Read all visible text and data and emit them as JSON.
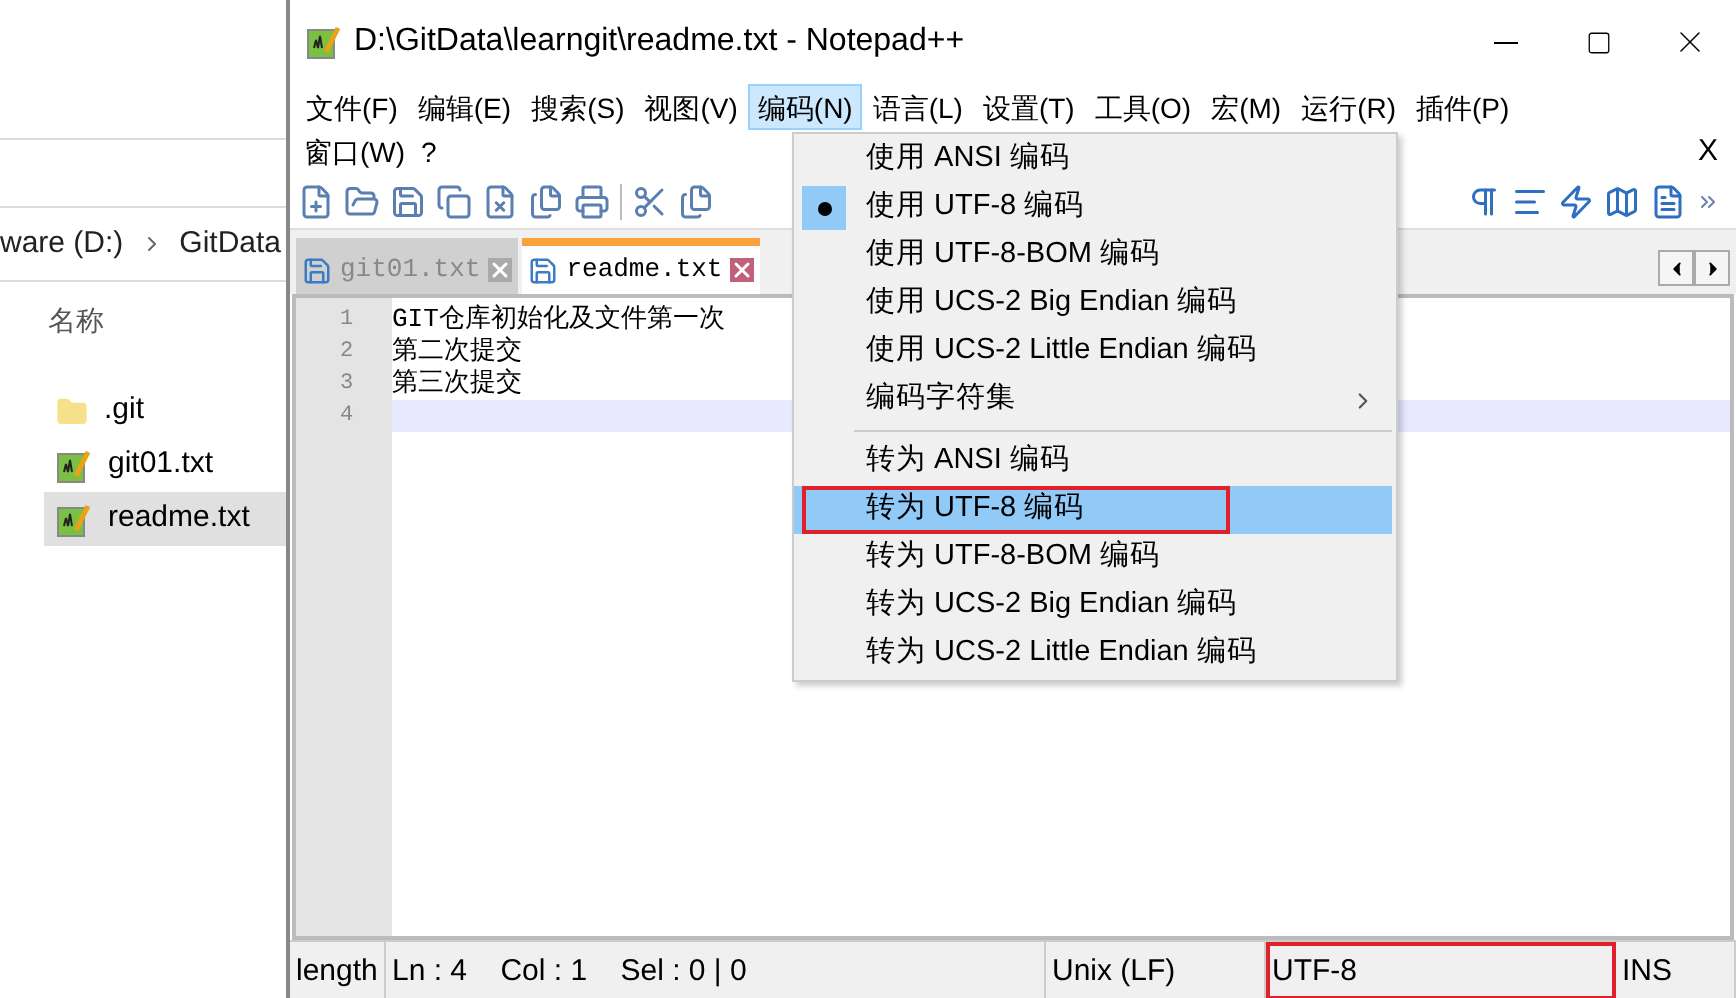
{
  "explorer": {
    "breadcrumb": [
      "ware (D:)",
      "GitData"
    ],
    "column_header": "名称",
    "files": [
      {
        "name": ".git",
        "kind": "folder",
        "selected": false
      },
      {
        "name": "git01.txt",
        "kind": "text",
        "selected": false
      },
      {
        "name": "readme.txt",
        "kind": "text",
        "selected": true
      }
    ]
  },
  "window": {
    "title": "D:\\GitData\\learngit\\readme.txt - Notepad++"
  },
  "menu_bar": [
    {
      "label": "文件(F)",
      "selected": false
    },
    {
      "label": "编辑(E)",
      "selected": false
    },
    {
      "label": "搜索(S)",
      "selected": false
    },
    {
      "label": "视图(V)",
      "selected": false
    },
    {
      "label": "编码(N)",
      "selected": true
    },
    {
      "label": "语言(L)",
      "selected": false
    },
    {
      "label": "设置(T)",
      "selected": false
    },
    {
      "label": "工具(O)",
      "selected": false
    },
    {
      "label": "宏(M)",
      "selected": false
    },
    {
      "label": "运行(R)",
      "selected": false
    },
    {
      "label": "插件(P)",
      "selected": false
    }
  ],
  "menu_bar_row2": [
    {
      "label": "窗口(W)",
      "selected": false
    },
    {
      "label": "?",
      "selected": false
    }
  ],
  "close_document": "X",
  "tabs": [
    {
      "label": "git01.txt",
      "selected": false
    },
    {
      "label": "readme.txt",
      "selected": true
    }
  ],
  "editor_lines": [
    {
      "number": "1",
      "text": "GIT仓库初始化及文件第一次",
      "current": false
    },
    {
      "number": "2",
      "text": "第二次提交",
      "current": false
    },
    {
      "number": "3",
      "text": "第三次提交",
      "current": false
    },
    {
      "number": "4",
      "current": true
    }
  ],
  "encoding_menu": [
    {
      "kind": "item",
      "label": "使用 ANSI 编码",
      "checked": false,
      "highlighted": false,
      "outlined": false
    },
    {
      "kind": "item",
      "label": "使用 UTF-8 编码",
      "checked": true,
      "highlighted": false,
      "outlined": false
    },
    {
      "kind": "item",
      "label": "使用 UTF-8-BOM 编码",
      "checked": false,
      "highlighted": false,
      "outlined": false
    },
    {
      "kind": "item",
      "label": "使用 UCS-2 Big Endian 编码",
      "checked": false,
      "highlighted": false,
      "outlined": false
    },
    {
      "kind": "item",
      "label": "使用 UCS-2 Little Endian 编码",
      "checked": false,
      "highlighted": false,
      "outlined": false
    },
    {
      "kind": "submenu",
      "label": "编码字符集",
      "checked": false,
      "highlighted": false,
      "outlined": false
    },
    {
      "kind": "separator"
    },
    {
      "kind": "item",
      "label": "转为 ANSI 编码",
      "checked": false,
      "highlighted": false,
      "outlined": false
    },
    {
      "kind": "item",
      "label": "转为 UTF-8 编码",
      "checked": false,
      "highlighted": true,
      "outlined": true
    },
    {
      "kind": "item",
      "label": "转为 UTF-8-BOM 编码",
      "checked": false,
      "highlighted": false,
      "outlined": false
    },
    {
      "kind": "item",
      "label": "转为 UCS-2 Big Endian 编码",
      "checked": false,
      "highlighted": false,
      "outlined": false
    },
    {
      "kind": "item",
      "label": "转为 UCS-2 Little Endian 编码",
      "checked": false,
      "highlighted": false,
      "outlined": false
    }
  ],
  "status_bar": [
    {
      "text": "length",
      "outlined": false
    },
    {
      "text": "Ln : 4    Col : 1    Sel : 0 | 0",
      "outlined": false
    },
    {
      "text": "Unix (LF)",
      "outlined": false
    },
    {
      "text": "UTF-8",
      "outlined": true
    },
    {
      "text": "INS",
      "outlined": false
    }
  ]
}
